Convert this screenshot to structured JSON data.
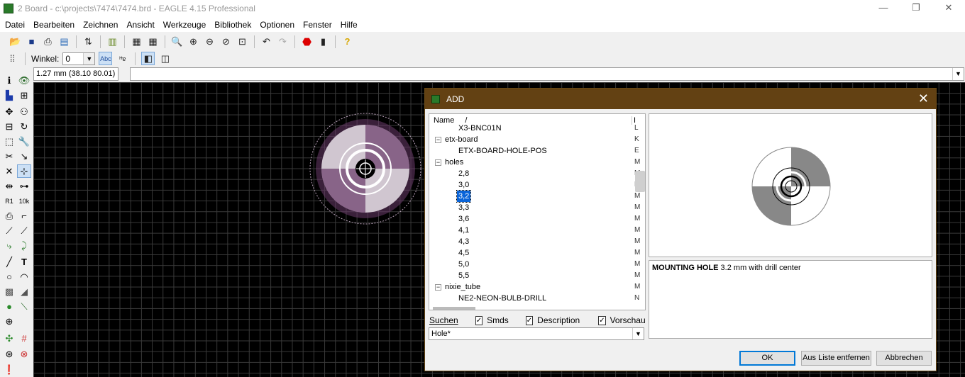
{
  "window": {
    "title": "2 Board - c:\\projects\\7474\\7474.brd - EAGLE 4.15 Professional",
    "controls": [
      "—",
      "❐",
      "✕"
    ]
  },
  "menu": [
    "Datei",
    "Bearbeiten",
    "Zeichnen",
    "Ansicht",
    "Werkzeuge",
    "Bibliothek",
    "Optionen",
    "Fenster",
    "Hilfe"
  ],
  "toolbar2": {
    "angle_label": "Winkel:",
    "angle_value": "0"
  },
  "status": {
    "coordinates": "1.27 mm (38.10 80.01)",
    "command": ""
  },
  "dialog": {
    "title": "ADD",
    "close": "✕",
    "tree_header": {
      "name": "Name",
      "sort": "/",
      "type": "I"
    },
    "tree_rows": [
      {
        "label": "X3-BNC01N",
        "type": "L",
        "indent": 2,
        "kind": "leaf"
      },
      {
        "label": "etx-board",
        "type": "K",
        "indent": 1,
        "kind": "group"
      },
      {
        "label": "ETX-BOARD-HOLE-POS",
        "type": "E",
        "indent": 2,
        "kind": "leaf"
      },
      {
        "label": "holes",
        "type": "M",
        "indent": 1,
        "kind": "group"
      },
      {
        "label": "2,8",
        "type": "M",
        "indent": 2,
        "kind": "leaf"
      },
      {
        "label": "3,0",
        "type": "M",
        "indent": 2,
        "kind": "leaf"
      },
      {
        "label": "3,2",
        "type": "M",
        "indent": 2,
        "kind": "leaf",
        "selected": true
      },
      {
        "label": "3,3",
        "type": "M",
        "indent": 2,
        "kind": "leaf"
      },
      {
        "label": "3,6",
        "type": "M",
        "indent": 2,
        "kind": "leaf"
      },
      {
        "label": "4,1",
        "type": "M",
        "indent": 2,
        "kind": "leaf"
      },
      {
        "label": "4,3",
        "type": "M",
        "indent": 2,
        "kind": "leaf"
      },
      {
        "label": "4,5",
        "type": "M",
        "indent": 2,
        "kind": "leaf"
      },
      {
        "label": "5,0",
        "type": "M",
        "indent": 2,
        "kind": "leaf"
      },
      {
        "label": "5,5",
        "type": "M",
        "indent": 2,
        "kind": "leaf"
      },
      {
        "label": "nixie_tube",
        "type": "M",
        "indent": 1,
        "kind": "group"
      },
      {
        "label": "NE2-NEON-BULB-DRILL",
        "type": "N",
        "indent": 2,
        "kind": "leaf"
      }
    ],
    "description_title": "MOUNTING HOLE",
    "description_text": " 3.2 mm with drill center",
    "search": {
      "label": "Suchen",
      "smds": "Smds",
      "description": "Description",
      "preview": "Vorschau",
      "value": "Hole*"
    },
    "buttons": {
      "ok": "OK",
      "remove": "Aus Liste entfernen",
      "cancel": "Abbrechen"
    }
  },
  "colors": {
    "dialog_title_bg": "#634113",
    "selection": "#0a64d8",
    "canvas": "#000000",
    "grid": "#3a3a3a"
  }
}
